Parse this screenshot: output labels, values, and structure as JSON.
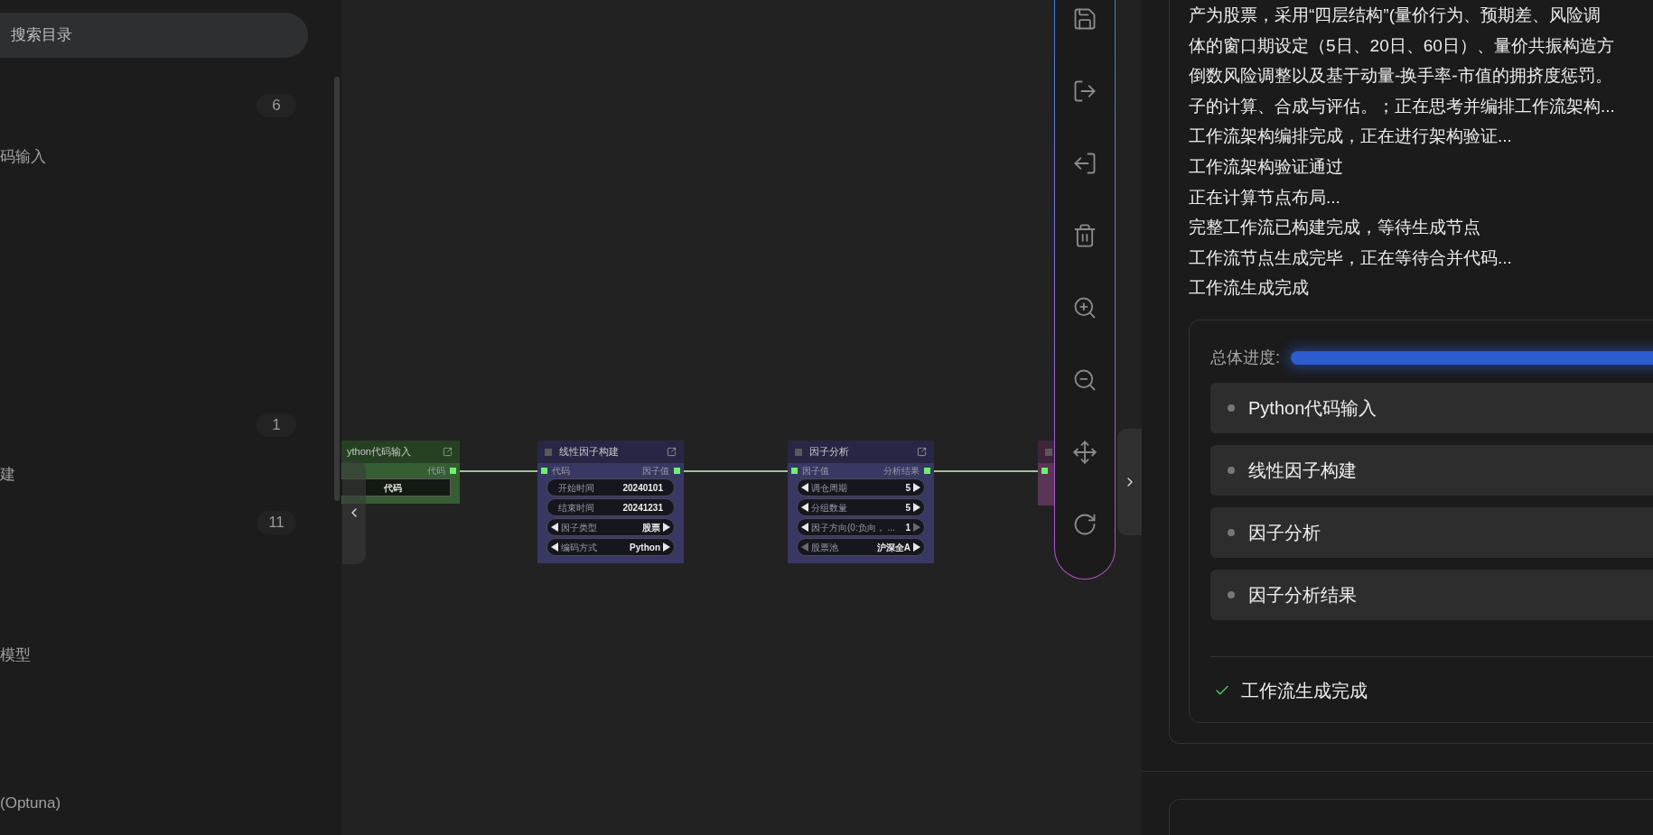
{
  "sidebar": {
    "search": {
      "placeholder": "搜索目录"
    },
    "entries": [
      {
        "kind": "count",
        "text": "6"
      },
      {
        "kind": "label",
        "text": "码输入"
      },
      {
        "kind": "count",
        "text": "1"
      },
      {
        "kind": "label",
        "text": "建"
      },
      {
        "kind": "count",
        "text": "11"
      },
      {
        "kind": "label",
        "text": "模型"
      },
      {
        "kind": "label",
        "text": "(Optuna)"
      }
    ]
  },
  "canvas": {
    "nodes": [
      {
        "title": "ython代码输入",
        "color": "#355e32",
        "output": {
          "label": "代码"
        },
        "widgets": [
          {
            "kind": "field",
            "value": "代码"
          }
        ]
      },
      {
        "title": "线性因子构建",
        "color": "#383863",
        "input": {
          "label": "代码"
        },
        "output": {
          "label": "因子值"
        },
        "widgets": [
          {
            "kind": "text",
            "label": "开始时间",
            "value": "20240101"
          },
          {
            "kind": "text",
            "label": "结束时间",
            "value": "20241231"
          },
          {
            "kind": "combo",
            "label": "因子类型",
            "value": "股票",
            "prev_enabled": true,
            "next_enabled": true
          },
          {
            "kind": "combo",
            "label": "编码方式",
            "value": "Python",
            "prev_enabled": true,
            "next_enabled": true
          }
        ]
      },
      {
        "title": "因子分析",
        "color": "#383863",
        "input": {
          "label": "因子值"
        },
        "output": {
          "label": "分析结果"
        },
        "widgets": [
          {
            "kind": "combo",
            "label": "调仓周期",
            "value": "5",
            "prev_enabled": true,
            "next_enabled": true
          },
          {
            "kind": "combo",
            "label": "分组数量",
            "value": "5",
            "prev_enabled": true,
            "next_enabled": true
          },
          {
            "kind": "combo",
            "label": "因子方向(0:负向， ...",
            "value": "1",
            "prev_enabled": true,
            "next_enabled": false
          },
          {
            "kind": "combo",
            "label": "股票池",
            "value": "沪深全A",
            "prev_enabled": false,
            "next_enabled": true
          }
        ]
      },
      {
        "color": "#5a3556",
        "input_port": true
      }
    ]
  },
  "log": {
    "lines": [
      "产为股票，采用“四层结构”(量价行为、预期差、风险调",
      "体的窗口期设定（5日、20日、60日）、量价共振构造方",
      "倒数风险调整以及基于动量-换手率-市值的拥挤度惩罚。",
      "子的计算、合成与评估。；正在思考并编排工作流架构...",
      "工作流架构编排完成，正在进行架构验证...",
      "工作流架构验证通过",
      "正在计算节点布局...",
      "完整工作流已构建完成，等待生成节点",
      "工作流节点生成完毕，正在等待合并代码...",
      "工作流生成完成"
    ]
  },
  "progress": {
    "label": "总体进度:",
    "level": 1.0,
    "steps": [
      "Python代码输入",
      "线性因子构建",
      "因子分析",
      "因子分析结果"
    ],
    "status": {
      "done": true,
      "text": "工作流生成完成"
    }
  }
}
